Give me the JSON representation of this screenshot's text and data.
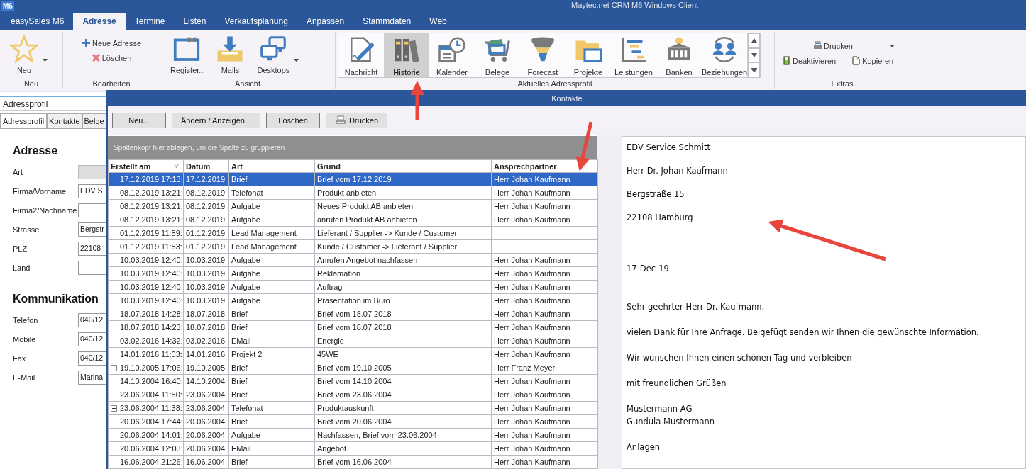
{
  "window": {
    "badge": "M6",
    "title": "Maytec.net CRM M6 Windows Client"
  },
  "menu_tabs": [
    {
      "label": "easySales M6",
      "selected": false
    },
    {
      "label": "Adresse",
      "selected": true
    },
    {
      "label": "Termine",
      "selected": false
    },
    {
      "label": "Listen",
      "selected": false
    },
    {
      "label": "Verkaufsplanung",
      "selected": false
    },
    {
      "label": "Anpassen",
      "selected": false
    },
    {
      "label": "Stammdaten",
      "selected": false
    },
    {
      "label": "Web",
      "selected": false
    }
  ],
  "ribbon": {
    "groups": [
      {
        "label": "Neu",
        "kind": "large",
        "items": [
          {
            "label": "Neu",
            "dropdown": true
          }
        ]
      },
      {
        "label": "Bearbeiten",
        "kind": "small",
        "items": [
          {
            "label": "Neue Adresse",
            "dropdown": false
          },
          {
            "label": "Löschen",
            "dropdown": false
          }
        ]
      },
      {
        "label": "Ansicht",
        "kind": "large",
        "items": [
          {
            "label": "Register..",
            "dropdown": false
          },
          {
            "label": "Mails",
            "dropdown": false
          },
          {
            "label": "Desktops",
            "dropdown": true
          }
        ]
      },
      {
        "label": "Aktuelles Adressprofil",
        "kind": "gallery",
        "items": [
          {
            "label": "Nachricht",
            "selected": false
          },
          {
            "label": "Historie",
            "selected": true
          },
          {
            "label": "Kalender",
            "selected": false
          },
          {
            "label": "Belege",
            "selected": false
          },
          {
            "label": "Forecast",
            "selected": false
          },
          {
            "label": "Projekte",
            "selected": false
          },
          {
            "label": "Leistungen",
            "selected": false
          },
          {
            "label": "Banken",
            "selected": false
          },
          {
            "label": "Beziehungen",
            "selected": false
          }
        ]
      },
      {
        "label": "Extras",
        "kind": "toolbar",
        "items": [
          {
            "label": "Drucken",
            "dropdown": true
          },
          {
            "label": "Deaktivieren",
            "dropdown": false
          },
          {
            "label": "Kopieren",
            "dropdown": false
          }
        ]
      }
    ]
  },
  "left_panel": {
    "profile_field": "Adressprofil",
    "tabs": [
      {
        "label": "Adressprofil",
        "selected": true
      },
      {
        "label": "Kontakte",
        "selected": false
      },
      {
        "label": "Belge",
        "selected": false
      }
    ],
    "sections": [
      {
        "title": "Adresse",
        "fields": [
          {
            "label": "Art",
            "disabled": true
          },
          {
            "label": "Firma/Vorname",
            "value": "EDV S",
            "disabled": false
          },
          {
            "label": "Firma2/Nachname",
            "disabled": false
          },
          {
            "label": "Strasse",
            "value": "Bergstr",
            "disabled": false
          },
          {
            "label": "PLZ",
            "value": "22108",
            "disabled": false
          },
          {
            "label": "Land",
            "disabled": false
          }
        ]
      },
      {
        "title": "Kommunikation",
        "fields": [
          {
            "label": "Telefon",
            "value": "040/12",
            "disabled": false
          },
          {
            "label": "Mobile",
            "value": "040/12",
            "disabled": false
          },
          {
            "label": "Fax",
            "value": "040/12",
            "disabled": false
          },
          {
            "label": "E-Mail",
            "value": "Marina",
            "disabled": false
          }
        ]
      }
    ]
  },
  "dialog": {
    "title": "Kontakte",
    "buttons": [
      "Neu...",
      "Ändern / Anzeigen...",
      "Löschen",
      "Drucken"
    ],
    "group_hint": "Spaltenkopf hier ablegen, um die Spalte zu gruppieren",
    "table": {
      "columns": [
        "Erstellt am",
        "Datum",
        "Art",
        "Grund",
        "Ansprechpartner"
      ],
      "rows": [
        {
          "cells": [
            "17.12.2019 17:13:",
            "17.12.2019",
            "Brief",
            "Brief vom 17.12.2019",
            "Herr Johan Kaufmann"
          ],
          "selected": true,
          "expandable": false
        },
        {
          "cells": [
            "08.12.2019 13:21:",
            "08.12.2019",
            "Telefonat",
            "Produkt anbieten",
            "Herr Johan Kaufmann"
          ],
          "selected": false,
          "expandable": false
        },
        {
          "cells": [
            "08.12.2019 13:21:",
            "08.12.2019",
            "Aufgabe",
            "Neues Produkt AB anbieten",
            "Herr Johan Kaufmann"
          ],
          "selected": false,
          "expandable": false
        },
        {
          "cells": [
            "08.12.2019 13:21:",
            "08.12.2019",
            "Aufgabe",
            "anrufen Produkt AB anbieten",
            "Herr Johan Kaufmann"
          ],
          "selected": false,
          "expandable": false
        },
        {
          "cells": [
            "01.12.2019 11:59:",
            "01.12.2019",
            "Lead Management",
            "Lieferant / Supplier -> Kunde / Customer",
            ""
          ],
          "selected": false,
          "expandable": false
        },
        {
          "cells": [
            "01.12.2019 11:53:",
            "01.12.2019",
            "Lead Management",
            "Kunde / Customer -> Lieferant / Supplier",
            ""
          ],
          "selected": false,
          "expandable": false
        },
        {
          "cells": [
            "10.03.2019 12:40:",
            "10.03.2019",
            "Aufgabe",
            "Anrufen Angebot nachfassen",
            "Herr Johan Kaufmann"
          ],
          "selected": false,
          "expandable": false
        },
        {
          "cells": [
            "10.03.2019 12:40:",
            "10.03.2019",
            "Aufgabe",
            "Reklamation",
            "Herr Johan Kaufmann"
          ],
          "selected": false,
          "expandable": false
        },
        {
          "cells": [
            "10.03.2019 12:40:",
            "10.03.2019",
            "Aufgabe",
            "Auftrag",
            "Herr Johan Kaufmann"
          ],
          "selected": false,
          "expandable": false
        },
        {
          "cells": [
            "10.03.2019 12:40:",
            "10.03.2019",
            "Aufgabe",
            "Präsentation im Büro",
            "Herr Johan Kaufmann"
          ],
          "selected": false,
          "expandable": false
        },
        {
          "cells": [
            "18.07.2018 14:28:",
            "18.07.2018",
            "Brief",
            "Brief vom 18.07.2018",
            "Herr Johan Kaufmann"
          ],
          "selected": false,
          "expandable": false
        },
        {
          "cells": [
            "18.07.2018 14:23:",
            "18.07.2018",
            "Brief",
            "Brief vom 18.07.2018",
            "Herr Johan Kaufmann"
          ],
          "selected": false,
          "expandable": false
        },
        {
          "cells": [
            "03.02.2016 14:32:",
            "03.02.2016",
            "EMail",
            "Energie",
            "Herr Johan Kaufmann"
          ],
          "selected": false,
          "expandable": false
        },
        {
          "cells": [
            "14.01.2016 11:03:",
            "14.01.2016",
            "Projekt 2",
            "45WE",
            "Herr Johan Kaufmann"
          ],
          "selected": false,
          "expandable": false
        },
        {
          "cells": [
            "19.10.2005 17:06:",
            "19.10.2005",
            "Brief",
            "Brief vom 19.10.2005",
            "Herr Franz Meyer"
          ],
          "selected": false,
          "expandable": true
        },
        {
          "cells": [
            "14.10.2004 16:40:",
            "14.10.2004",
            "Brief",
            "Brief vom 14.10.2004",
            "Herr Johan Kaufmann"
          ],
          "selected": false,
          "expandable": false
        },
        {
          "cells": [
            "23.06.2004 11:50:",
            "23.06.2004",
            "Brief",
            "Brief vom 23.06.2004",
            "Herr Johan Kaufmann"
          ],
          "selected": false,
          "expandable": false
        },
        {
          "cells": [
            "23.06.2004 11:38:",
            "23.06.2004",
            "Telefonat",
            "Produktauskunft",
            "Herr Johan Kaufmann"
          ],
          "selected": false,
          "expandable": true
        },
        {
          "cells": [
            "20.06.2004 17:44:",
            "20.06.2004",
            "Brief",
            "Brief vom 20.06.2004",
            "Herr Johan Kaufmann"
          ],
          "selected": false,
          "expandable": false
        },
        {
          "cells": [
            "20.06.2004 14:01:",
            "20.06.2004",
            "Aufgabe",
            "Nachfassen, Brief vom 23.06.2004",
            "Herr Johan Kaufmann"
          ],
          "selected": false,
          "expandable": false
        },
        {
          "cells": [
            "20.06.2004 12:03:",
            "20.06.2004",
            "EMail",
            "Angebot",
            "Herr Johan Kaufmann"
          ],
          "selected": false,
          "expandable": false
        },
        {
          "cells": [
            "16.06.2004 21:26:",
            "16.06.2004",
            "Brief",
            "Brief vom 16.06.2004",
            "Herr Johan Kaufmann"
          ],
          "selected": false,
          "expandable": false
        }
      ]
    },
    "letter": {
      "paragraphs": [
        {
          "kind": "address",
          "lines": [
            "EDV Service Schmitt"
          ]
        },
        {
          "kind": "address",
          "lines": [
            "Herr Dr. Johan Kaufmann"
          ]
        },
        {
          "kind": "address",
          "lines": [
            "Bergstraße 15"
          ]
        },
        {
          "kind": "address",
          "lines": [
            "22108 Hamburg"
          ]
        },
        {
          "kind": "date",
          "lines": [
            "17-Dec-19"
          ]
        },
        {
          "kind": "salutation",
          "lines": [
            "Sehr geehrter Herr Dr. Kaufmann,"
          ]
        },
        {
          "kind": "body",
          "lines": [
            "vielen Dank für Ihre Anfrage. Beigefügt senden wir Ihnen die gewünschte Information."
          ]
        },
        {
          "kind": "body",
          "lines": [
            "Wir wünschen Ihnen einen schönen Tag und verbleiben"
          ]
        },
        {
          "kind": "body",
          "lines": [
            "mit freundlichen Grüßen"
          ]
        },
        {
          "kind": "body",
          "lines": [
            "Mustermann AG",
            "Gundula Mustermann"
          ]
        },
        {
          "kind": "attachment",
          "lines": [
            "Anlagen"
          ]
        }
      ]
    }
  }
}
